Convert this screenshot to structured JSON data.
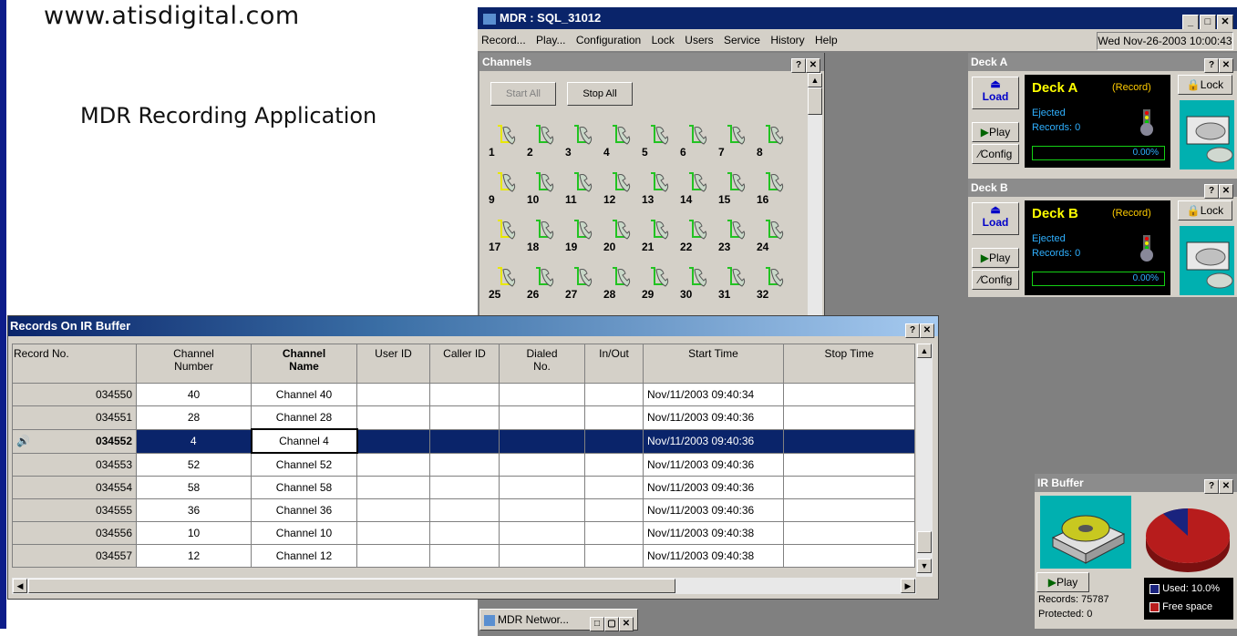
{
  "header": {
    "website": "www.atisdigital.com",
    "app_title": "MDR Recording Application"
  },
  "window": {
    "title": "MDR : SQL_31012",
    "datetime": "Wed Nov-26-2003  10:00:43"
  },
  "menu": [
    "Record...",
    "Play...",
    "Configuration",
    "Lock",
    "Users",
    "Service",
    "History",
    "Help"
  ],
  "channels_pane": {
    "title": "Channels",
    "start_all": "Start All",
    "stop_all": "Stop All",
    "channels": [
      "1",
      "2",
      "3",
      "4",
      "5",
      "6",
      "7",
      "8",
      "9",
      "10",
      "11",
      "12",
      "13",
      "14",
      "15",
      "16",
      "17",
      "18",
      "19",
      "20",
      "21",
      "22",
      "23",
      "24",
      "25",
      "26",
      "27",
      "28",
      "29",
      "30",
      "31",
      "32"
    ],
    "accent_green": "#22c322",
    "accent_yellow": "#e8e800"
  },
  "deck_a": {
    "title": "Deck A",
    "name": "Deck A",
    "mode": "(Record)",
    "status": "Ejected",
    "records": "Records: 0",
    "percent": "0.00%",
    "load": "Load",
    "play": "Play",
    "config": "Config",
    "lock": "Lock"
  },
  "deck_b": {
    "title": "Deck B",
    "name": "Deck B",
    "mode": "(Record)",
    "status": "Ejected",
    "records": "Records: 0",
    "percent": "0.00%",
    "load": "Load",
    "play": "Play",
    "config": "Config",
    "lock": "Lock"
  },
  "records": {
    "title": "Records On IR Buffer",
    "columns": [
      "Record No.",
      "Channel\nNumber",
      "Channel\nName",
      "User ID",
      "Caller ID",
      "Dialed\nNo.",
      "In/Out",
      "Start Time",
      "Stop Time"
    ],
    "rows": [
      {
        "rec": "034550",
        "num": "40",
        "name": "Channel 40",
        "start": "Nov/11/2003 09:40:34"
      },
      {
        "rec": "034551",
        "num": "28",
        "name": "Channel 28",
        "start": "Nov/11/2003 09:40:36"
      },
      {
        "rec": "034552",
        "num": "4",
        "name": "Channel 4",
        "start": "Nov/11/2003 09:40:36"
      },
      {
        "rec": "034553",
        "num": "52",
        "name": "Channel 52",
        "start": "Nov/11/2003 09:40:36"
      },
      {
        "rec": "034554",
        "num": "58",
        "name": "Channel 58",
        "start": "Nov/11/2003 09:40:36"
      },
      {
        "rec": "034555",
        "num": "36",
        "name": "Channel 36",
        "start": "Nov/11/2003 09:40:36"
      },
      {
        "rec": "034556",
        "num": "10",
        "name": "Channel 10",
        "start": "Nov/11/2003 09:40:38"
      },
      {
        "rec": "034557",
        "num": "12",
        "name": "Channel 12",
        "start": "Nov/11/2003 09:40:38"
      }
    ],
    "selected_index": 2
  },
  "ir_buffer": {
    "title": "IR Buffer",
    "play": "Play",
    "records": "Records: 75787",
    "protected": "Protected: 0",
    "used": "Used: 10.0%",
    "free": "Free space",
    "used_fraction": 0.1,
    "used_color": "#1a237e",
    "free_color": "#b71c1c"
  },
  "taskbar": {
    "label": "MDR Networ..."
  }
}
